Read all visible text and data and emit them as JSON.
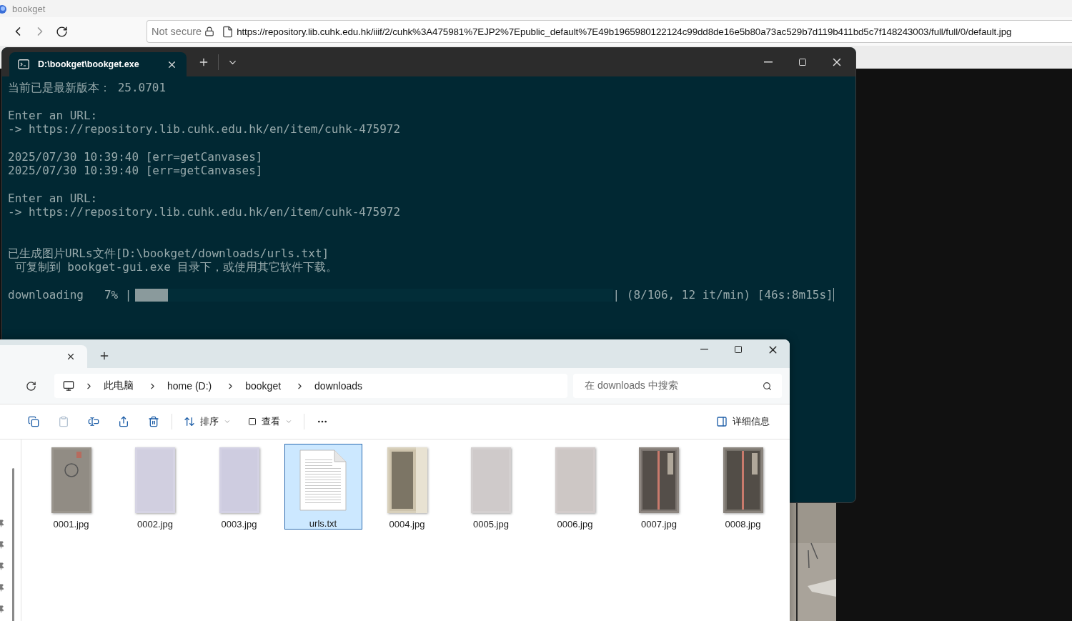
{
  "browser": {
    "title": "bookget",
    "address_bar": {
      "security": "Not secure",
      "url": "https://repository.lib.cuhk.edu.hk/iiif/2/cuhk%3A475981%7EJP2%7Epublic_default%7E49b1965980122124c99dd8de16e5b80a73ac529b7d119b411bd5c7f148243003/full/full/0/default.jpg"
    }
  },
  "terminal": {
    "tabs": [
      {
        "title": "D:\\bookget\\bookget.exe",
        "selected": true
      }
    ],
    "blocks": [
      {
        "kind": "version",
        "lines": [
          "当前已是最新版本： 25.0701"
        ]
      },
      {
        "kind": "prompt",
        "lines": [
          "Enter an URL:",
          "-> https://repository.lib.cuhk.edu.hk/en/item/cuhk-475972"
        ]
      },
      {
        "kind": "log",
        "lines": [
          "2025/07/30 10:39:40 [err=getCanvases]",
          "2025/07/30 10:39:40 [err=getCanvases]"
        ]
      },
      {
        "kind": "prompt",
        "lines": [
          "Enter an URL:",
          "-> https://repository.lib.cuhk.edu.hk/en/item/cuhk-475972"
        ]
      },
      {
        "kind": "notice",
        "lines": [
          "已生成图片URLs文件[D:\\bookget/downloads/urls.txt]",
          " 可复制到 bookget-gui.exe 目录下，或使用其它软件下载。"
        ]
      }
    ],
    "progress": {
      "label": "downloading",
      "percent": "7% |",
      "level": 0.07,
      "stats": "| (8/106, 12 it/min) [46s:8m15s]"
    }
  },
  "explorer": {
    "tabs": [
      {
        "selected": true
      }
    ],
    "breadcrumbs": [
      "此电脑",
      "home (D:)",
      "bookget",
      "downloads"
    ],
    "search": {
      "placeholder": "在 downloads 中搜索"
    },
    "toolbar": [
      {
        "kind": "copy",
        "disabled": false
      },
      {
        "kind": "paste",
        "disabled": true
      },
      {
        "kind": "rename",
        "disabled": false
      },
      {
        "kind": "share",
        "disabled": false
      },
      {
        "kind": "delete",
        "disabled": false
      },
      {
        "kind": "sort",
        "label": "排序",
        "disabled": false
      },
      {
        "kind": "view",
        "label": "查看",
        "disabled": false
      },
      {
        "kind": "more"
      }
    ],
    "details": "详细信息",
    "files": [
      {
        "name": "0001.jpg",
        "selected": false
      },
      {
        "name": "0002.jpg",
        "selected": false
      },
      {
        "name": "0003.jpg",
        "selected": false
      },
      {
        "name": "urls.txt",
        "kind": "document",
        "selected": true
      },
      {
        "name": "0004.jpg",
        "selected": false
      },
      {
        "name": "0005.jpg",
        "selected": false
      },
      {
        "name": "0006.jpg",
        "selected": false
      },
      {
        "name": "0007.jpg",
        "selected": false
      },
      {
        "name": "0008.jpg",
        "selected": false
      }
    ]
  }
}
